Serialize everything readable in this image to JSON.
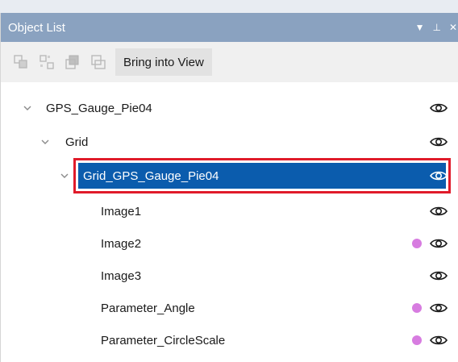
{
  "panel": {
    "title": "Object List",
    "controls": [
      "▼",
      "⊥",
      "✕"
    ]
  },
  "toolbar": {
    "icons": [
      "group-icon",
      "ungroup-icon",
      "bring-front-icon",
      "send-back-icon"
    ],
    "bring_into_view_label": "Bring into View"
  },
  "colors": {
    "titlebar": "#8aa2c0",
    "selection": "#0b5cad",
    "highlight_border": "#e01b2a",
    "dot": "#d77ce0"
  },
  "tree": {
    "items": [
      {
        "label": "GPS_Gauge_Pie04",
        "expandable": true,
        "expanded": true,
        "visible": true,
        "dot": false,
        "selected": false
      },
      {
        "label": "Grid",
        "expandable": true,
        "expanded": true,
        "visible": true,
        "dot": false,
        "selected": false
      },
      {
        "label": "Grid_GPS_Gauge_Pie04",
        "expandable": true,
        "expanded": true,
        "visible": true,
        "dot": false,
        "selected": true
      },
      {
        "label": "Image1",
        "expandable": false,
        "visible": true,
        "dot": false,
        "selected": false
      },
      {
        "label": "Image2",
        "expandable": false,
        "visible": true,
        "dot": true,
        "selected": false
      },
      {
        "label": "Image3",
        "expandable": false,
        "visible": true,
        "dot": false,
        "selected": false
      },
      {
        "label": "Parameter_Angle",
        "expandable": false,
        "visible": true,
        "dot": true,
        "selected": false
      },
      {
        "label": "Parameter_CircleScale",
        "expandable": false,
        "visible": true,
        "dot": true,
        "selected": false
      }
    ]
  }
}
